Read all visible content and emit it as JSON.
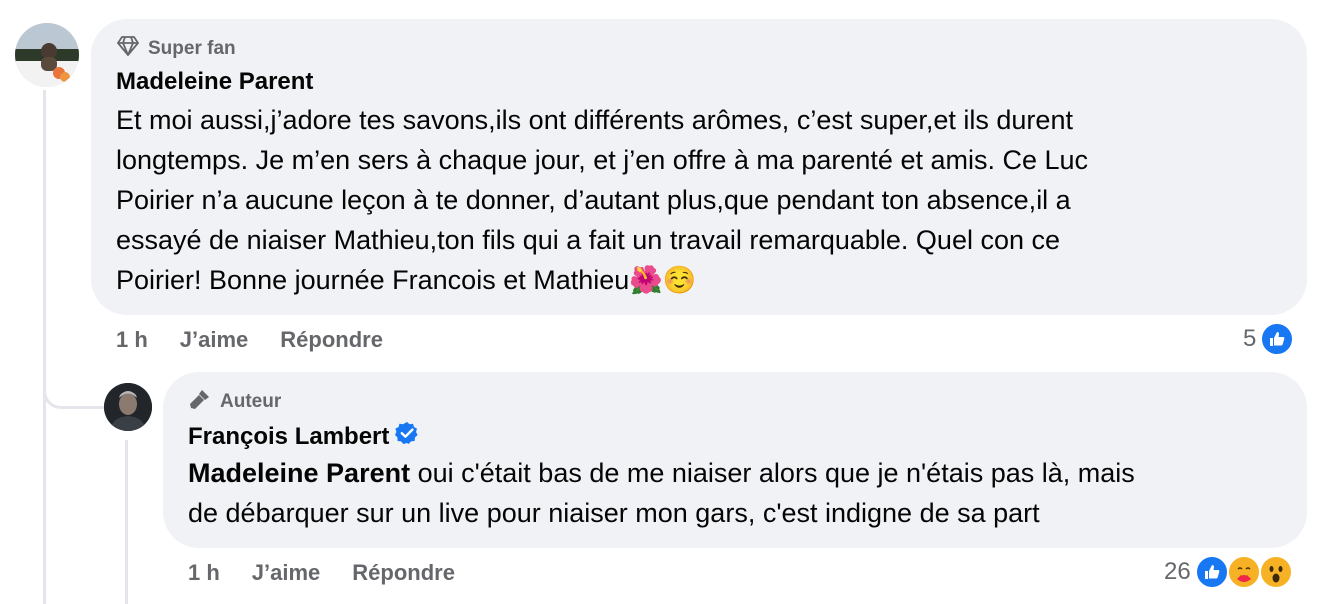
{
  "comment1": {
    "badge": "Super fan",
    "author": "Madeleine Parent",
    "lines": [
      "Et moi aussi,j’adore tes savons,ils ont différents arômes, c’est super,et ils durent",
      "longtemps. Je m’en sers à chaque jour, et j’en offre à ma parenté et amis. Ce Luc",
      "Poirier n’a aucune leçon à te donner, d’autant plus,que pendant ton absence,il a",
      "essayé de niaiser Mathieu,ton fils qui a fait un travail remarquable. Quel con ce",
      "Poirier! Bonne journée Francois et Mathieu"
    ],
    "emojis": "🌺☺️",
    "time": "1 h",
    "like_label": "J’aime",
    "reply_label": "Répondre",
    "reaction_count": "5"
  },
  "comment2": {
    "badge": "Auteur",
    "author": "François Lambert",
    "mention": "Madeleine Parent",
    "line1_rest": " oui c'était bas de me niaiser alors que je n'étais pas là, mais",
    "line2": "de débarquer sur un live pour niaiser mon gars, c'est indigne de sa part",
    "time": "1 h",
    "like_label": "J’aime",
    "reply_label": "Répondre",
    "reaction_count": "26"
  },
  "colors": {
    "bubble": "#f0f2f5",
    "secondary_text": "#65676b",
    "like_blue": "#1877f2",
    "verified_blue": "#1877f2"
  }
}
